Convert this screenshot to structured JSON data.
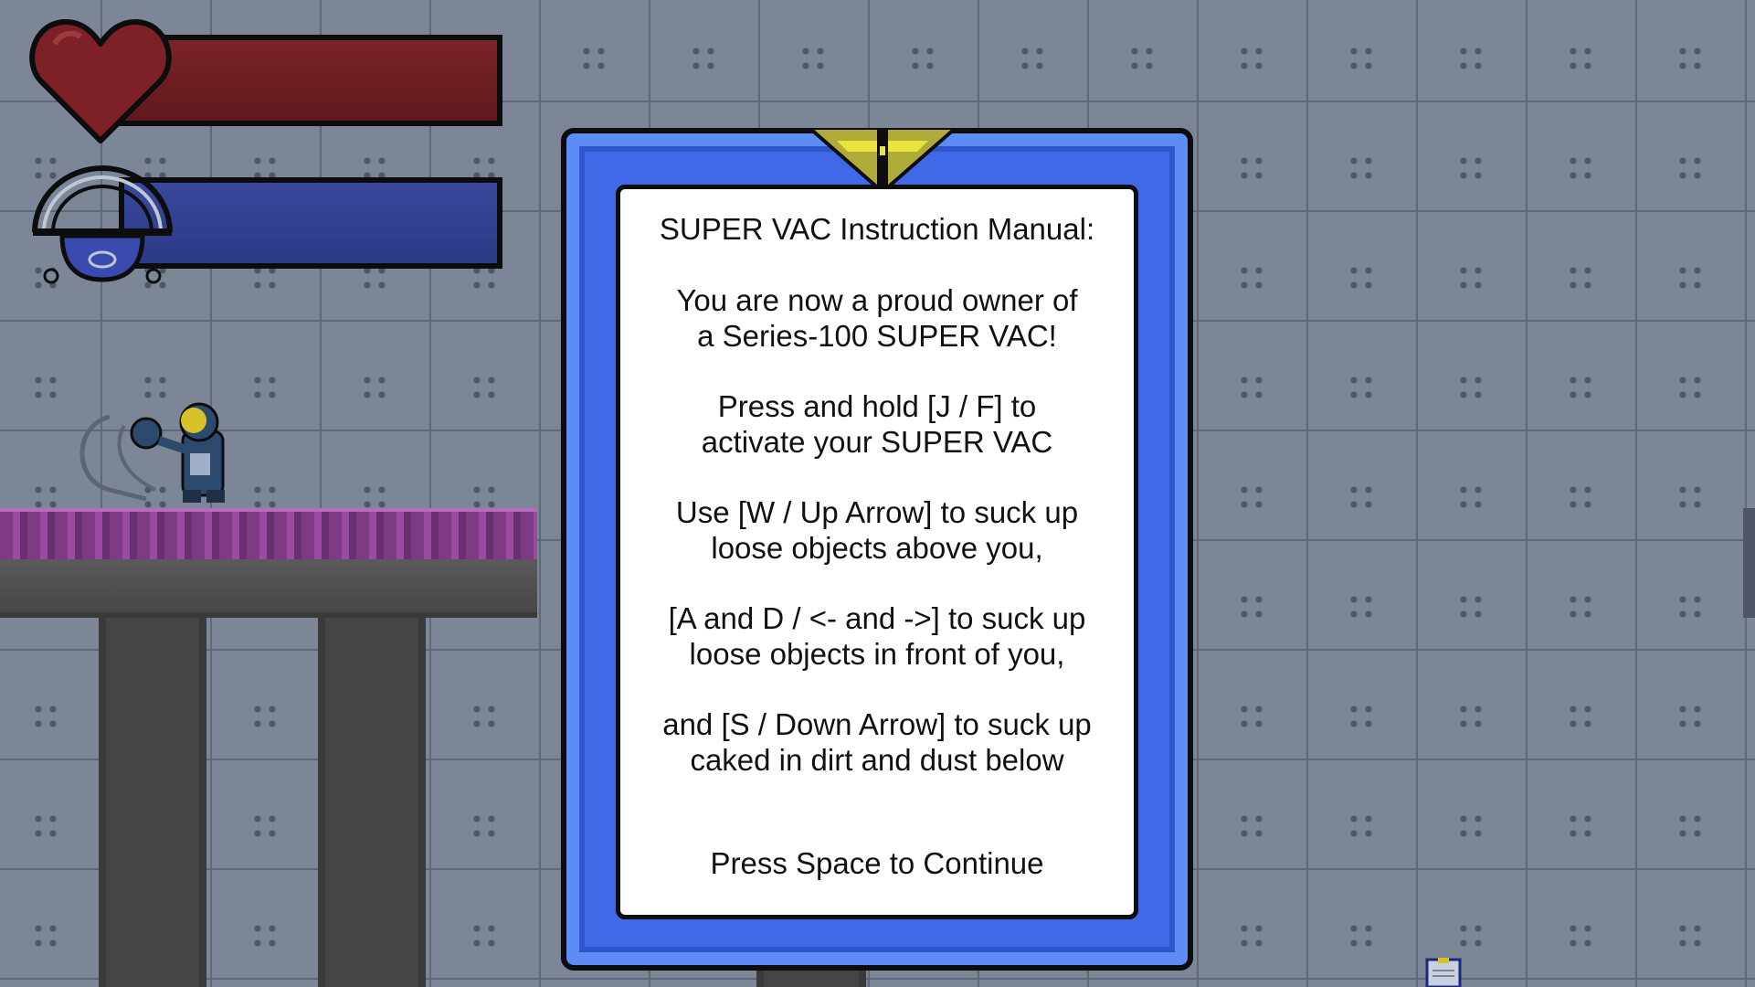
{
  "hud": {
    "health_icon": "heart-icon",
    "health_level": 1.0,
    "vac_icon": "vacuum-icon",
    "vac_level": 1.0,
    "colors": {
      "health": "#6a1d21",
      "vac": "#2f3e8c"
    }
  },
  "manual": {
    "title": "SUPER VAC Instruction Manual:",
    "intro_line1": "You are now a proud owner of",
    "intro_line2": "a Series-100 SUPER VAC!",
    "activate_line1": "Press and hold [J / F] to",
    "activate_line2": "activate your SUPER VAC",
    "up_line1": "Use [W / Up Arrow] to suck up",
    "up_line2": "loose objects above you,",
    "side_line1": "[A and D / <- and ->] to suck up",
    "side_line2": "loose objects in front of you,",
    "down_line1": "and [S / Down Arrow] to suck up",
    "down_line2": "caked in dirt and dust below",
    "continue_prompt": "Press Space to Continue",
    "colors": {
      "frame": "#3f69e6",
      "page": "#ffffff",
      "clip": "#d9d23a"
    }
  }
}
